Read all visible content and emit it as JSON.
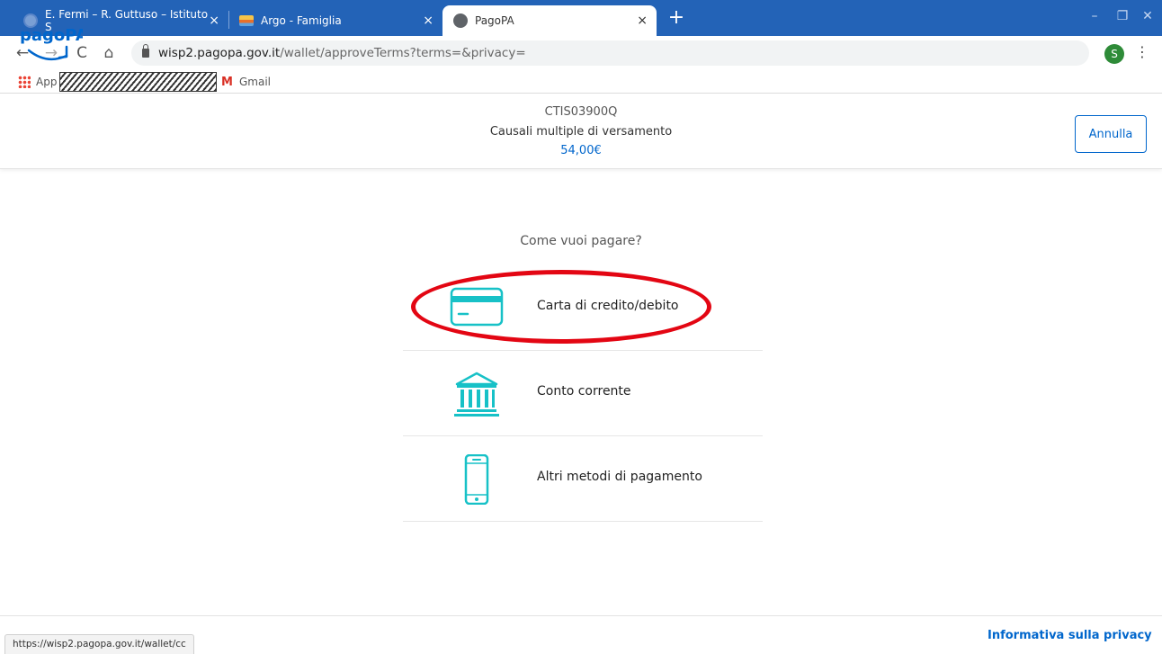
{
  "browser": {
    "tabs": [
      {
        "title": "E. Fermi – R. Guttuso – Istituto S",
        "close": "×"
      },
      {
        "title": "Argo - Famiglia",
        "close": "×"
      },
      {
        "title": "PagoPA",
        "close": "×"
      }
    ],
    "new_tab": "+",
    "window_controls": {
      "minimize": "–",
      "restore": "❐",
      "close": "✕"
    },
    "nav": {
      "back": "←",
      "forward": "→",
      "reload": "C",
      "home": "⌂"
    },
    "url": {
      "host": "wisp2.pagopa.gov.it",
      "path": "/wallet/approveTerms?terms=&privacy="
    },
    "star": "☆",
    "profile_initial": "S",
    "menu": "⋮",
    "bookmarks": {
      "apps": "App",
      "gmail_icon": "M",
      "gmail": "Gmail"
    },
    "status_url": "https://wisp2.pagopa.gov.it/wallet/cc"
  },
  "header": {
    "logo_text": "pagoPA",
    "code": "CTIS03900Q",
    "description": "Causali multiple di versamento",
    "amount": "54,00€",
    "cancel_label": "Annulla"
  },
  "main": {
    "question": "Come vuoi pagare?",
    "methods": [
      {
        "label": "Carta di credito/debito",
        "icon": "credit-card-icon"
      },
      {
        "label": "Conto corrente",
        "icon": "bank-icon"
      },
      {
        "label": "Altri metodi di pagamento",
        "icon": "smartphone-icon"
      }
    ]
  },
  "footer": {
    "privacy_link": "Informativa sulla privacy"
  },
  "colors": {
    "accent": "#0066cc",
    "icon": "#17c1c7",
    "highlight": "#e30613",
    "tabbar": "#2363b7"
  }
}
